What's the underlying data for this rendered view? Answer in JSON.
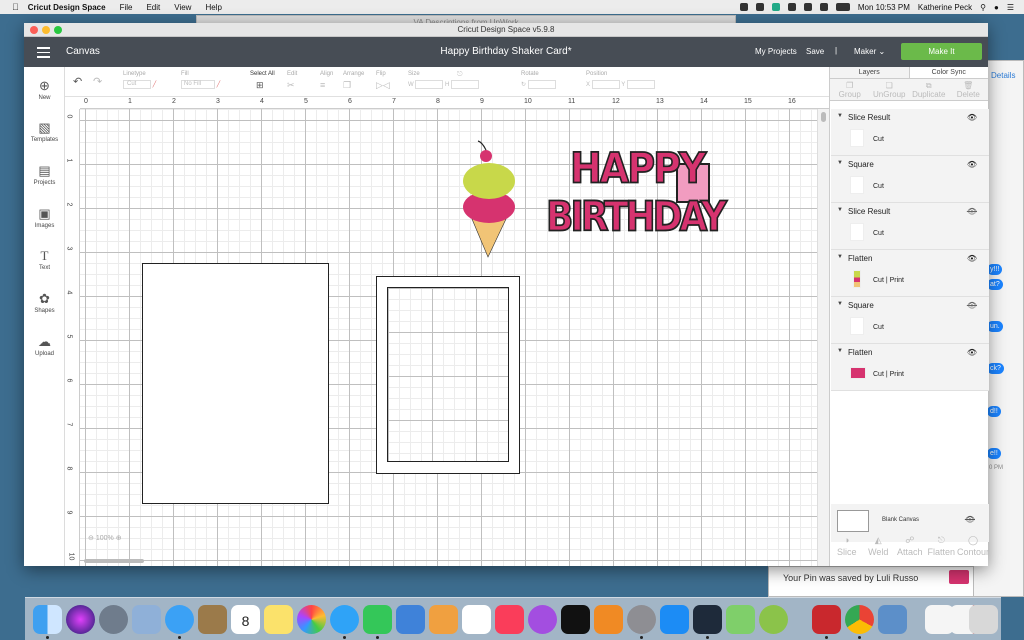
{
  "menubar": {
    "app_name": "Cricut Design Space",
    "menus": [
      "File",
      "Edit",
      "View",
      "Help"
    ],
    "clock": "Mon 10:53 PM",
    "user": "Katherine Peck"
  },
  "background": {
    "window_title": "VA Descriptions from UpWork",
    "side_tab": "Details",
    "chat_snippets": [
      "y!!!",
      "at?",
      "un.",
      "ck?",
      "d!!",
      "e!!",
      "0 PM"
    ],
    "notification": "Your Pin was saved by Luli Russo"
  },
  "window": {
    "title": "Cricut Design Space  v5.9.8"
  },
  "header": {
    "canvas_label": "Canvas",
    "project_name": "Happy Birthday Shaker Card*",
    "my_projects": "My Projects",
    "save": "Save",
    "separator": "|",
    "machine": "Maker",
    "make_it": "Make It"
  },
  "left_sidebar": [
    {
      "label": "New",
      "icon": "plus-circle-icon"
    },
    {
      "label": "Templates",
      "icon": "shirt-icon"
    },
    {
      "label": "Projects",
      "icon": "projects-icon"
    },
    {
      "label": "Images",
      "icon": "image-icon"
    },
    {
      "label": "Text",
      "icon": "text-icon"
    },
    {
      "label": "Shapes",
      "icon": "shapes-icon"
    },
    {
      "label": "Upload",
      "icon": "upload-icon"
    }
  ],
  "toolbar": {
    "linetype_label": "Linetype",
    "linetype_value": "Cut",
    "fill_label": "Fill",
    "fill_value": "No Fill",
    "select_all": "Select All",
    "edit": "Edit",
    "align": "Align",
    "arrange": "Arrange",
    "flip": "Flip",
    "size": "Size",
    "size_w": "W",
    "size_h": "H",
    "rotate": "Rotate",
    "position": "Position",
    "pos_x": "X",
    "pos_y": "Y"
  },
  "ruler": {
    "h": [
      "0",
      "1",
      "2",
      "3",
      "4",
      "5",
      "6",
      "7",
      "8",
      "9",
      "10",
      "11",
      "12",
      "13",
      "14",
      "15",
      "16"
    ],
    "v": [
      "0",
      "1",
      "2",
      "3",
      "4",
      "5",
      "6",
      "7",
      "8",
      "9",
      "10"
    ]
  },
  "canvas": {
    "zoom": "100%",
    "art_text_line1": "HAPPY",
    "art_text_line2": "BIRTHDAY"
  },
  "layers_panel": {
    "tabs": [
      "Layers",
      "Color Sync"
    ],
    "actions": [
      "Group",
      "UnGroup",
      "Duplicate",
      "Delete"
    ],
    "layers": [
      {
        "name": "Slice Result",
        "op": "Cut",
        "visible": true
      },
      {
        "name": "Square",
        "op": "Cut",
        "visible": true
      },
      {
        "name": "Slice Result",
        "op": "Cut",
        "visible": false
      },
      {
        "name": "Flatten",
        "op": "Cut  |  Print",
        "visible": true
      },
      {
        "name": "Square",
        "op": "Cut",
        "visible": false
      },
      {
        "name": "Flatten",
        "op": "Cut  |  Print",
        "visible": true
      }
    ],
    "blank_canvas": "Blank Canvas",
    "bottom_actions": [
      "Slice",
      "Weld",
      "Attach",
      "Flatten",
      "Contour"
    ]
  },
  "colors": {
    "header_bg": "#474d55",
    "make_it": "#6bba4a",
    "pink": "#d6336f",
    "cream": "#c8d84a"
  }
}
